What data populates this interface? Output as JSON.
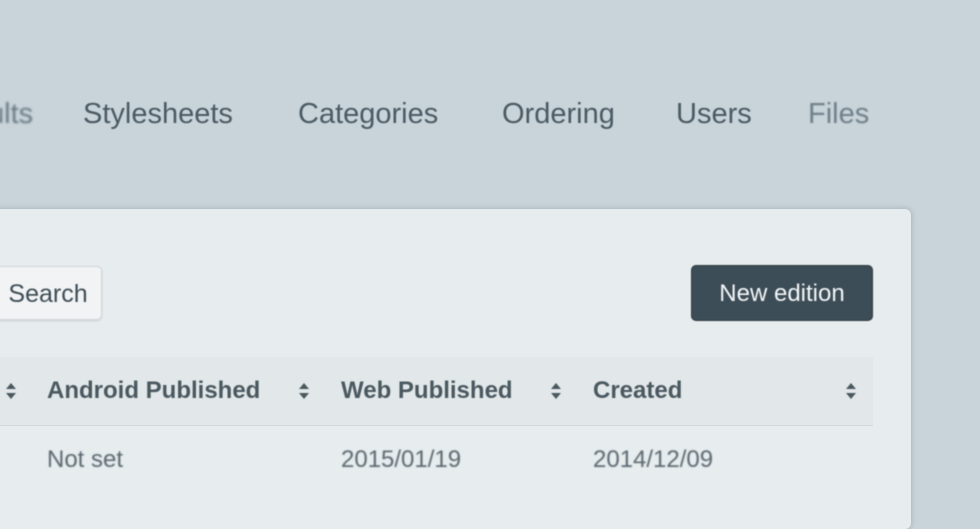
{
  "nav": {
    "items": [
      {
        "label": "ults"
      },
      {
        "label": "Stylesheets"
      },
      {
        "label": "Categories"
      },
      {
        "label": "Ordering"
      },
      {
        "label": "Users"
      },
      {
        "label": "Files"
      }
    ]
  },
  "toolbar": {
    "search_label": "Search",
    "new_edition_label": "New edition"
  },
  "table": {
    "headers": [
      "Android Published",
      "Web Published",
      "Created"
    ],
    "rows": [
      [
        "Not set",
        "2015/01/19",
        "2014/12/09"
      ]
    ]
  },
  "colors": {
    "page_background": "#c9d3da",
    "panel_background": "#e7ecee",
    "primary_button": "#3d4d57"
  }
}
